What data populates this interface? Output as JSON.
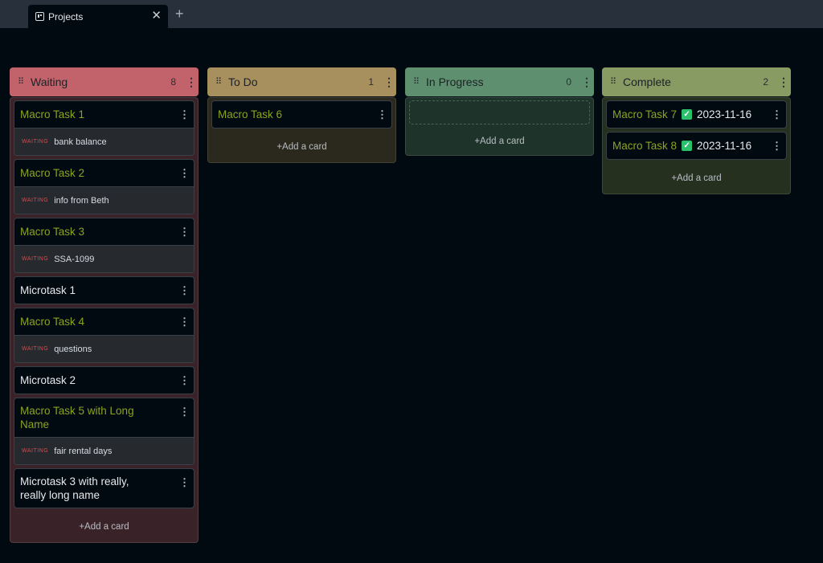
{
  "tab": {
    "title": "Projects",
    "close": "✕",
    "new": "+"
  },
  "columns": {
    "waiting": {
      "title": "Waiting",
      "count": "8",
      "add_label": "+Add a card",
      "cards": [
        {
          "title": "Macro Task 1",
          "tag": "WAITING",
          "sub": "bank balance"
        },
        {
          "title": "Macro Task 2",
          "tag": "WAITING",
          "sub": "info from Beth"
        },
        {
          "title": "Macro Task 3",
          "tag": "WAITING",
          "sub": "SSA-1099"
        },
        {
          "title": "Microtask 1"
        },
        {
          "title": "Macro Task 4",
          "tag": "WAITING",
          "sub": "questions"
        },
        {
          "title": "Microtask 2"
        },
        {
          "title": "Macro Task 5 with Long Name",
          "tag": "WAITING",
          "sub": "fair rental days"
        },
        {
          "title": "Microtask 3 with really, really long name"
        }
      ]
    },
    "todo": {
      "title": "To Do",
      "count": "1",
      "add_label": "+Add a card",
      "cards": [
        {
          "title": "Macro Task 6"
        }
      ]
    },
    "inprogress": {
      "title": "In Progress",
      "count": "0",
      "add_label": "+Add a card",
      "cards": []
    },
    "complete": {
      "title": "Complete",
      "count": "2",
      "add_label": "+Add a card",
      "cards": [
        {
          "title": "Macro Task 7",
          "date": "2023-11-16"
        },
        {
          "title": "Macro Task 8",
          "date": "2023-11-16"
        }
      ]
    }
  },
  "colors": {
    "waiting_header": "#c2636b",
    "waiting_body": "#3a2328",
    "todo_header": "#a88f5e",
    "todo_body": "#2b281d",
    "inprogress_header": "#5e9070",
    "inprogress_body": "#1e3329",
    "complete_header": "#879b63",
    "complete_body": "#25301f",
    "macro_title": "#8ba31e",
    "waiting_tag": "#d84a4a",
    "check": "#2bc06c"
  },
  "icons": {
    "drag": "drag-handle-icon",
    "menu": "kebab-menu-icon",
    "check": "check-box-icon",
    "tab": "board-icon"
  }
}
